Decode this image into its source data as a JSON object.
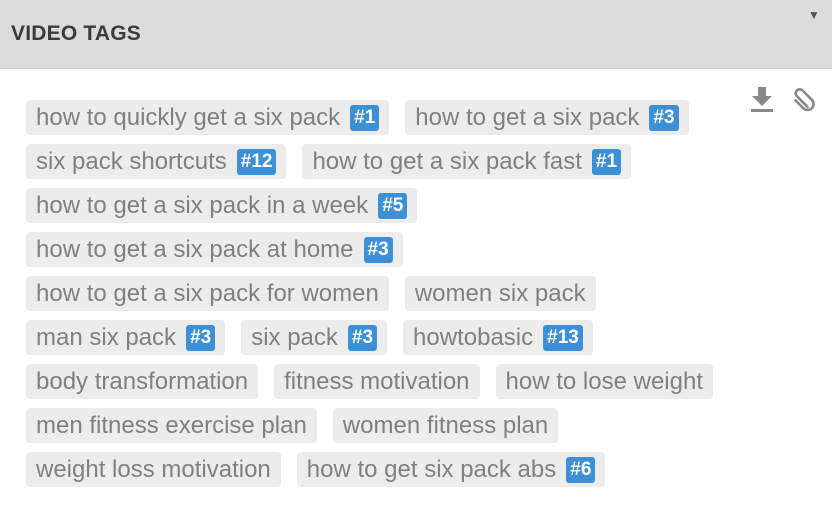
{
  "panel": {
    "title": "VIDEO TAGS",
    "collapse_glyph": "▼"
  },
  "tools": {
    "download_icon": "download-icon",
    "clip_icon": "paperclip-icon",
    "icon_color": "#8a8a8a"
  },
  "colors": {
    "header_bg": "#dcdcdc",
    "tag_bg": "#ececec",
    "tag_text": "#808080",
    "rank_badge": "#3d8fd6"
  },
  "tag_rows": [
    [
      {
        "label": "how to quickly get a six pack",
        "rank": "#1"
      },
      {
        "label": "how to get a six pack",
        "rank": "#3"
      }
    ],
    [
      {
        "label": "six pack shortcuts",
        "rank": "#12"
      },
      {
        "label": "how to get a six pack fast",
        "rank": "#1"
      }
    ],
    [
      {
        "label": "how to get a six pack in a week",
        "rank": "#5"
      }
    ],
    [
      {
        "label": "how to get a six pack at home",
        "rank": "#3"
      }
    ],
    [
      {
        "label": "how to get a six pack for women",
        "rank": ""
      },
      {
        "label": "women six pack",
        "rank": ""
      }
    ],
    [
      {
        "label": "man six pack",
        "rank": "#3"
      },
      {
        "label": "six pack",
        "rank": "#3"
      },
      {
        "label": "howtobasic",
        "rank": "#13"
      }
    ],
    [
      {
        "label": "body transformation",
        "rank": ""
      },
      {
        "label": "fitness motivation",
        "rank": ""
      },
      {
        "label": "how to lose weight",
        "rank": ""
      }
    ],
    [
      {
        "label": "men fitness exercise plan",
        "rank": ""
      },
      {
        "label": "women fitness plan",
        "rank": ""
      }
    ],
    [
      {
        "label": "weight loss motivation",
        "rank": ""
      },
      {
        "label": "how to get six pack abs",
        "rank": "#6"
      }
    ]
  ]
}
